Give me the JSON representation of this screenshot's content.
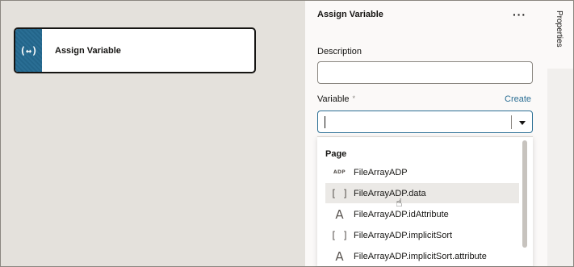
{
  "canvas": {
    "node": {
      "icon": "assign-variable-icon",
      "icon_glyph": "(↔)",
      "label": "Assign Variable"
    }
  },
  "panel": {
    "title": "Assign Variable",
    "menu_glyph": "···",
    "description_label": "Description",
    "description_value": "",
    "variable_label": "Variable",
    "required_marker": "*",
    "create_link": "Create",
    "variable_value": "",
    "dropdown": {
      "group": "Page",
      "options": [
        {
          "icon": "ADP",
          "type": "adp-icon",
          "label": "FileArrayADP"
        },
        {
          "icon": "[ ]",
          "type": "array-icon",
          "label": "FileArrayADP.data"
        },
        {
          "icon": "A",
          "type": "string-icon",
          "label": "FileArrayADP.idAttribute"
        },
        {
          "icon": "[ ]",
          "type": "array-icon",
          "label": "FileArrayADP.implicitSort"
        },
        {
          "icon": "A",
          "type": "string-icon",
          "label": "FileArrayADP.implicitSort.attribute"
        }
      ]
    }
  },
  "tabs": {
    "properties": "Properties"
  },
  "colors": {
    "accent": "#2a6e94",
    "canvas_bg": "#e4e1dc",
    "panel_bg": "#fbf9f8"
  }
}
